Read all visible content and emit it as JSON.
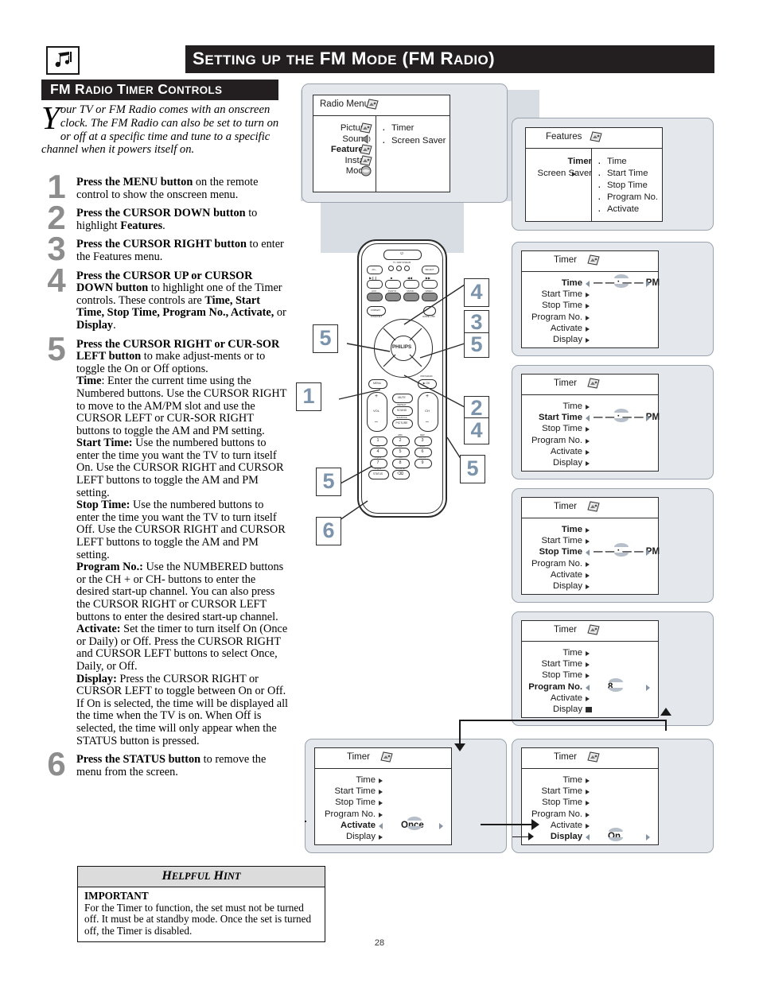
{
  "header": {
    "icon": "music-note-icon",
    "title_parts": [
      {
        "t": "S",
        "cap": true
      },
      {
        "t": "ETTING",
        "cap": false
      },
      {
        "t": " ",
        "cap": false
      },
      {
        "t": "UP",
        "cap": false
      },
      {
        "t": " ",
        "cap": false
      },
      {
        "t": "THE",
        "cap": false
      },
      {
        "t": " ",
        "cap": false
      },
      {
        "t": "FM",
        "cap": true
      },
      {
        "t": " ",
        "cap": false
      },
      {
        "t": "M",
        "cap": true
      },
      {
        "t": "ODE",
        "cap": false
      },
      {
        "t": " (FM R",
        "cap": true
      },
      {
        "t": "ADIO",
        "cap": false
      },
      {
        "t": ")",
        "cap": true
      }
    ],
    "title_text": "Setting up the FM Mode (FM Radio)"
  },
  "section": {
    "title": "FM Radio Timer Controls"
  },
  "intro": {
    "dropcap": "Y",
    "text": "our TV or FM Radio comes with an onscreen clock. The FM Radio can also be set to turn on or off at a specific time and tune to a specific channel when it powers itself on."
  },
  "steps": [
    {
      "num": "1",
      "html": "<b>Press the MENU button</b> on the remote control to show the onscreen menu."
    },
    {
      "num": "2",
      "html": "<b>Press the CURSOR DOWN button</b> to highlight <b>Features</b>."
    },
    {
      "num": "3",
      "html": "<b>Press the CURSOR RIGHT button</b> to enter the Features menu."
    },
    {
      "num": "4",
      "html": "<b>Press the CURSOR UP or CURSOR DOWN button</b> to highlight one of the Timer controls. These controls are <b>Time, Start Time, Stop Time, Program No., Activate,</b> or <b>Display</b>."
    },
    {
      "num": "5",
      "html": "<b>Press the CURSOR RIGHT or CUR-SOR LEFT button</b> to make adjust-ments or to toggle the On or Off options.<br><b>Time</b>: Enter the current time using the Numbered buttons. Use the CURSOR RIGHT to move to the AM/PM slot and use the CURSOR LEFT or CUR-SOR RIGHT buttons to toggle the AM and PM setting.<br><b>Start Time:</b> Use the numbered buttons to enter the time you want the TV to turn itself On. Use the CURSOR RIGHT and CURSOR LEFT buttons to toggle the AM and PM setting.<br><b>Stop Time:</b> Use the numbered buttons to enter the time you want the TV to turn itself Off. Use the CURSOR RIGHT and CURSOR LEFT buttons to toggle the AM and PM setting.<br><b>Program No.:</b> Use the NUMBERED buttons or the CH + or CH- buttons to enter the desired start-up channel.  You can also press the CURSOR RIGHT or CURSOR LEFT buttons to enter the desired start-up channel.<br><b>Activate:</b> Set the timer to turn itself On (Once or Daily) or Off. Press the CURSOR RIGHT and CURSOR LEFT buttons to select Once, Daily, or Off.<br><b>Display:</b> Press the CURSOR RIGHT or CURSOR LEFT to toggle between On or Off. If On is selected, the time will be displayed all the time when the TV is on. When Off is selected, the time will only appear when the STATUS button is pressed."
    },
    {
      "num": "6",
      "html": "<b>Press the STATUS button</b> to remove the menu from the screen."
    }
  ],
  "hint": {
    "heading": "Helpful Hint",
    "important_label": "IMPORTANT",
    "body": "For the Timer to function, the set must not be turned off. It must be at standby mode. Once the set is turned off, the Timer is disabled."
  },
  "page_number": "28",
  "osd": {
    "radio_menu": {
      "title": "Radio Menu",
      "title_icon": "menu-pictogram-icon",
      "left_items": [
        {
          "label": "Picture",
          "bold": false,
          "icon": "picture-icon"
        },
        {
          "label": "Sound",
          "bold": false,
          "icon": "sound-icon"
        },
        {
          "label": "Features",
          "bold": true,
          "icon": "features-icon"
        },
        {
          "label": "Install",
          "bold": false,
          "icon": "install-icon"
        },
        {
          "label": "Mode",
          "bold": false,
          "icon": "mode-icon"
        }
      ],
      "right_items": [
        "Timer",
        "Screen Saver"
      ]
    },
    "features_menu": {
      "title": "Features",
      "title_icon": "features-icon",
      "left_items": [
        {
          "label": "Timer",
          "bold": true,
          "arrow": false
        },
        {
          "label": "Screen Saver",
          "bold": false,
          "arrow": true
        }
      ],
      "right_items": [
        "Time",
        "Start Time",
        "Stop Time",
        "Program No.",
        "Activate"
      ]
    },
    "timer_screens": [
      {
        "key": "timer-time",
        "title": "Timer",
        "title_icon": "features-icon",
        "rows": [
          {
            "label": "Time",
            "bold": true,
            "mark": "lr",
            "value": "— — : — —  PM",
            "updown": true
          },
          {
            "label": "Start Time",
            "bold": false,
            "mark": "arrow"
          },
          {
            "label": "Stop Time",
            "bold": false,
            "mark": "arrow"
          },
          {
            "label": "Program No.",
            "bold": false,
            "mark": "arrow"
          },
          {
            "label": "Activate",
            "bold": false,
            "mark": "arrow"
          },
          {
            "label": "Display",
            "bold": false,
            "mark": "arrow"
          }
        ]
      },
      {
        "key": "timer-start-time",
        "title": "Timer",
        "title_icon": "features-icon",
        "rows": [
          {
            "label": "Time",
            "bold": false,
            "mark": "arrow"
          },
          {
            "label": "Start Time",
            "bold": true,
            "mark": "lr",
            "value": "— — : — —  PM",
            "updown": true
          },
          {
            "label": "Stop Time",
            "bold": false,
            "mark": "arrow"
          },
          {
            "label": "Program No.",
            "bold": false,
            "mark": "arrow"
          },
          {
            "label": "Activate",
            "bold": false,
            "mark": "arrow"
          },
          {
            "label": "Display",
            "bold": false,
            "mark": "arrow"
          }
        ]
      },
      {
        "key": "timer-stop-time",
        "title": "Timer",
        "title_icon": "features-icon",
        "rows": [
          {
            "label": "Time",
            "bold": true,
            "mark": "arrow"
          },
          {
            "label": "Start Time",
            "bold": false,
            "mark": "arrow"
          },
          {
            "label": "Stop Time",
            "bold": true,
            "mark": "lr",
            "value": "— — : — —  PM",
            "updown": true
          },
          {
            "label": "Program No.",
            "bold": false,
            "mark": "arrow"
          },
          {
            "label": "Activate",
            "bold": false,
            "mark": "arrow"
          },
          {
            "label": "Display",
            "bold": false,
            "mark": "arrow"
          }
        ]
      },
      {
        "key": "timer-program-no",
        "title": "Timer",
        "title_icon": "features-icon",
        "rows": [
          {
            "label": "Time",
            "bold": false,
            "mark": "arrow"
          },
          {
            "label": "Start Time",
            "bold": false,
            "mark": "arrow"
          },
          {
            "label": "Stop Time",
            "bold": false,
            "mark": "arrow"
          },
          {
            "label": "Program No.",
            "bold": true,
            "mark": "lr",
            "value": "8",
            "updown": true
          },
          {
            "label": "Activate",
            "bold": false,
            "mark": "arrow"
          },
          {
            "label": "Display",
            "bold": false,
            "mark": "square"
          }
        ]
      },
      {
        "key": "timer-activate",
        "title": "Timer",
        "title_icon": "features-icon",
        "rows": [
          {
            "label": "Time",
            "bold": false,
            "mark": "arrow"
          },
          {
            "label": "Start Time",
            "bold": false,
            "mark": "arrow"
          },
          {
            "label": "Stop Time",
            "bold": false,
            "mark": "arrow"
          },
          {
            "label": "Program No.",
            "bold": false,
            "mark": "arrow"
          },
          {
            "label": "Activate",
            "bold": true,
            "mark": "lr",
            "value": "Once",
            "updown": true
          },
          {
            "label": "Display",
            "bold": false,
            "mark": "arrow"
          }
        ]
      },
      {
        "key": "timer-display",
        "title": "Timer",
        "title_icon": "features-icon",
        "rows": [
          {
            "label": "Time",
            "bold": false,
            "mark": "arrow"
          },
          {
            "label": "Start Time",
            "bold": false,
            "mark": "arrow"
          },
          {
            "label": "Stop Time",
            "bold": false,
            "mark": "arrow"
          },
          {
            "label": "Program No.",
            "bold": false,
            "mark": "arrow"
          },
          {
            "label": "Activate",
            "bold": false,
            "mark": "arrow"
          },
          {
            "label": "Display",
            "bold": true,
            "mark": "lr",
            "value": "On",
            "updown": true,
            "pointer": true
          }
        ]
      }
    ]
  },
  "remote": {
    "brand": "PHILIPS",
    "power_glyph": "⏻",
    "top_labels": [
      "TV",
      "DMR",
      "STREAM"
    ],
    "buttons": [
      {
        "name": "av-plus",
        "label": "AV+"
      },
      {
        "name": "select",
        "label": "SELECT"
      },
      {
        "name": "play-pause",
        "label": "▶❙❙"
      },
      {
        "name": "stop",
        "label": "■"
      },
      {
        "name": "prev",
        "label": "◀◀"
      },
      {
        "name": "next",
        "label": "▶▶"
      },
      {
        "name": "aux",
        "label": "AUX"
      },
      {
        "name": "photo",
        "label": "PHOTO"
      },
      {
        "name": "music",
        "label": "MUSIC"
      },
      {
        "name": "video",
        "label": "VIDEO"
      },
      {
        "name": "format",
        "label": "FORMAT"
      },
      {
        "name": "internet",
        "label": "INTERNET"
      },
      {
        "name": "home-link",
        "label": "HOME LINK"
      },
      {
        "name": "menu",
        "label": "MENU"
      },
      {
        "name": "ok",
        "label": "▶ OK"
      },
      {
        "name": "program",
        "label": "PROGRAM"
      },
      {
        "name": "mute",
        "label": "MUTE"
      },
      {
        "name": "sound",
        "label": "SOUND"
      },
      {
        "name": "repeat",
        "label": "REPEAT"
      },
      {
        "name": "picture",
        "label": "PICTURE"
      },
      {
        "name": "shuffle",
        "label": "SHUFFLE"
      },
      {
        "name": "volume",
        "label": "VOL"
      },
      {
        "name": "channel",
        "label": "CH"
      },
      {
        "name": "status",
        "label": "STATUS"
      },
      {
        "name": "zoom",
        "label": "ZOOM"
      }
    ],
    "keypad": [
      {
        "key": "1",
        "alt": "."
      },
      {
        "key": "2",
        "alt": "ABC"
      },
      {
        "key": "3",
        "alt": "DEF"
      },
      {
        "key": "4",
        "alt": "GHI"
      },
      {
        "key": "5",
        "alt": "JKL"
      },
      {
        "key": "6",
        "alt": "MNO"
      },
      {
        "key": "7",
        "alt": "PQRS"
      },
      {
        "key": "8",
        "alt": "TUV"
      },
      {
        "key": "9",
        "alt": "WXYZ"
      },
      {
        "key": "0",
        "alt": "␣"
      },
      {
        "key": "⌫",
        "alt": "ROTATE"
      }
    ]
  },
  "callouts": [
    {
      "n": "4",
      "target": "cursor-up"
    },
    {
      "n": "3",
      "target": "cursor-right"
    },
    {
      "n": "5",
      "target": "cursor-right"
    },
    {
      "n": "5",
      "target": "cursor-left"
    },
    {
      "n": "1",
      "target": "menu-button"
    },
    {
      "n": "2",
      "target": "cursor-down"
    },
    {
      "n": "4",
      "target": "cursor-down"
    },
    {
      "n": "5",
      "target": "ch-minus"
    },
    {
      "n": "5",
      "target": "numbered-buttons"
    },
    {
      "n": "6",
      "target": "status-button"
    }
  ],
  "colors": {
    "bar": "#231f20",
    "step_number": "#8d8d8d",
    "callout_number": "#7b93ab",
    "panel_bg": "#e4e8ed",
    "hint_heading_bg": "#dcdcdc"
  }
}
